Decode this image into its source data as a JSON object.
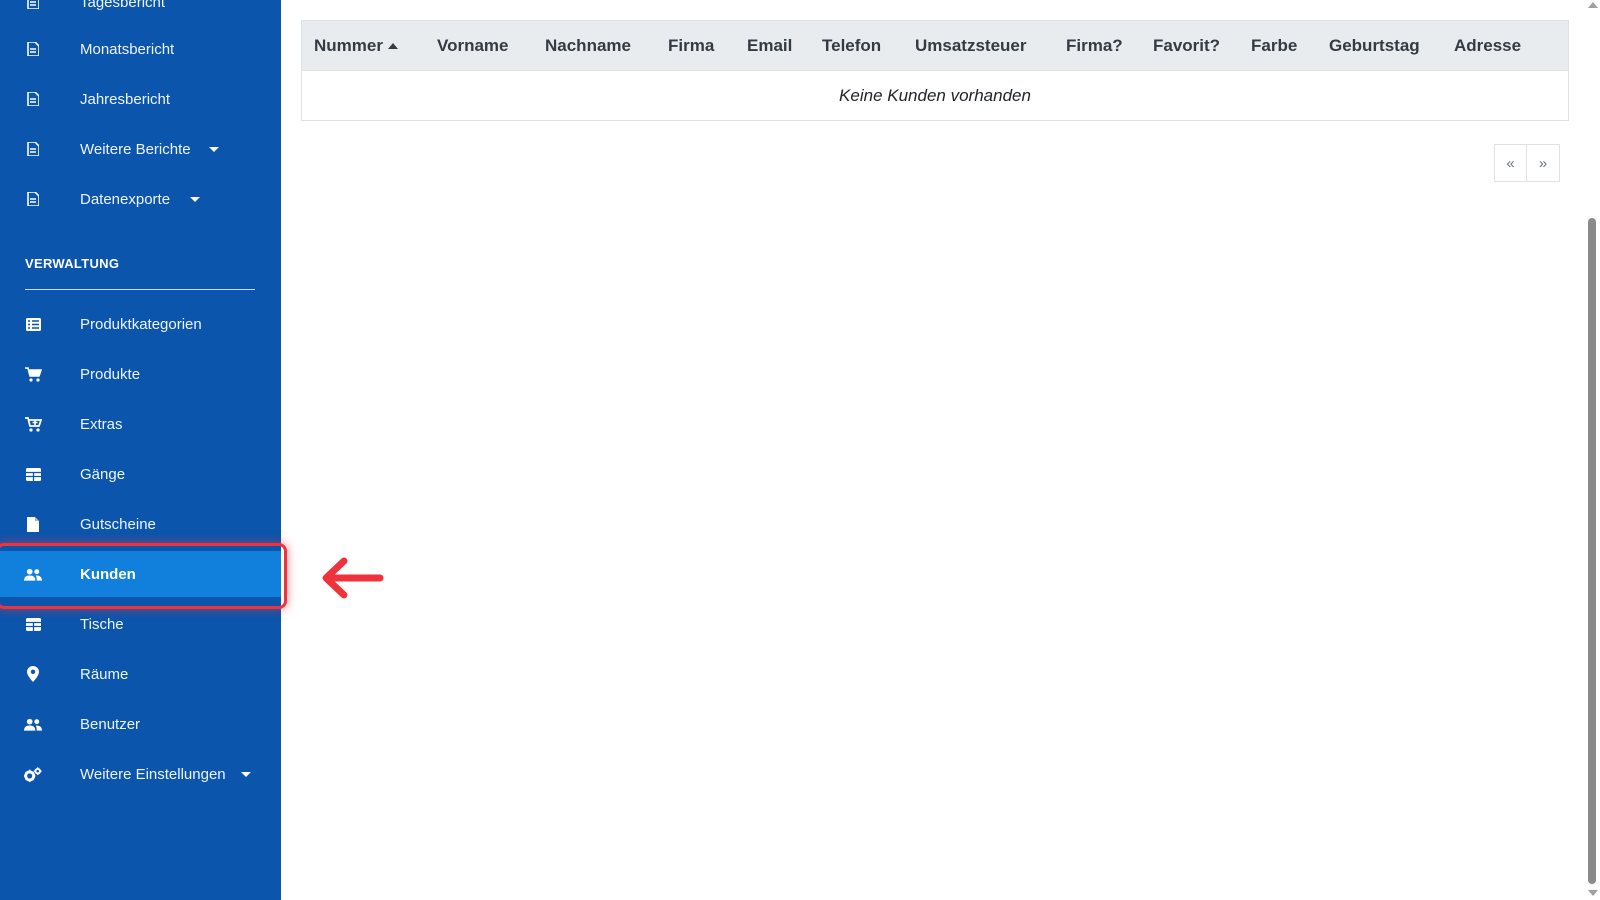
{
  "sidebar": {
    "items_top": [
      {
        "label": "Tagesbericht",
        "icon": "document-icon"
      },
      {
        "label": "Monatsbericht",
        "icon": "document-icon"
      },
      {
        "label": "Jahresbericht",
        "icon": "document-icon"
      },
      {
        "label": "Weitere Berichte",
        "icon": "document-icon",
        "dropdown": true
      },
      {
        "label": "Datenexporte",
        "icon": "document-icon",
        "dropdown": true
      }
    ],
    "section_title": "VERWALTUNG",
    "items_admin": [
      {
        "label": "Produktkategorien",
        "icon": "list-icon"
      },
      {
        "label": "Produkte",
        "icon": "cart-icon"
      },
      {
        "label": "Extras",
        "icon": "cart-plus-icon"
      },
      {
        "label": "Gänge",
        "icon": "table-icon"
      },
      {
        "label": "Gutscheine",
        "icon": "file-icon"
      },
      {
        "label": "Kunden",
        "icon": "users-icon",
        "active": true
      },
      {
        "label": "Tische",
        "icon": "table-icon"
      },
      {
        "label": "Räume",
        "icon": "map-marker-icon"
      },
      {
        "label": "Benutzer",
        "icon": "users-icon"
      },
      {
        "label": "Weitere Einstellungen",
        "icon": "cogs-icon",
        "dropdown": true
      }
    ]
  },
  "table": {
    "columns": [
      "Nummer",
      "Vorname",
      "Nachname",
      "Firma",
      "Email",
      "Telefon",
      "Umsatzsteuer",
      "Firma?",
      "Favorit?",
      "Farbe",
      "Geburtstag",
      "Adresse"
    ],
    "sorted_column": "Nummer",
    "sort_direction": "ascending",
    "empty_message": "Keine Kunden vorhanden"
  },
  "pagination": {
    "prev_label": "«",
    "next_label": "»"
  },
  "colors": {
    "sidebar_bg": "#0b55ad",
    "active_item_bg": "#1180dc",
    "highlight": "#f0323c"
  }
}
